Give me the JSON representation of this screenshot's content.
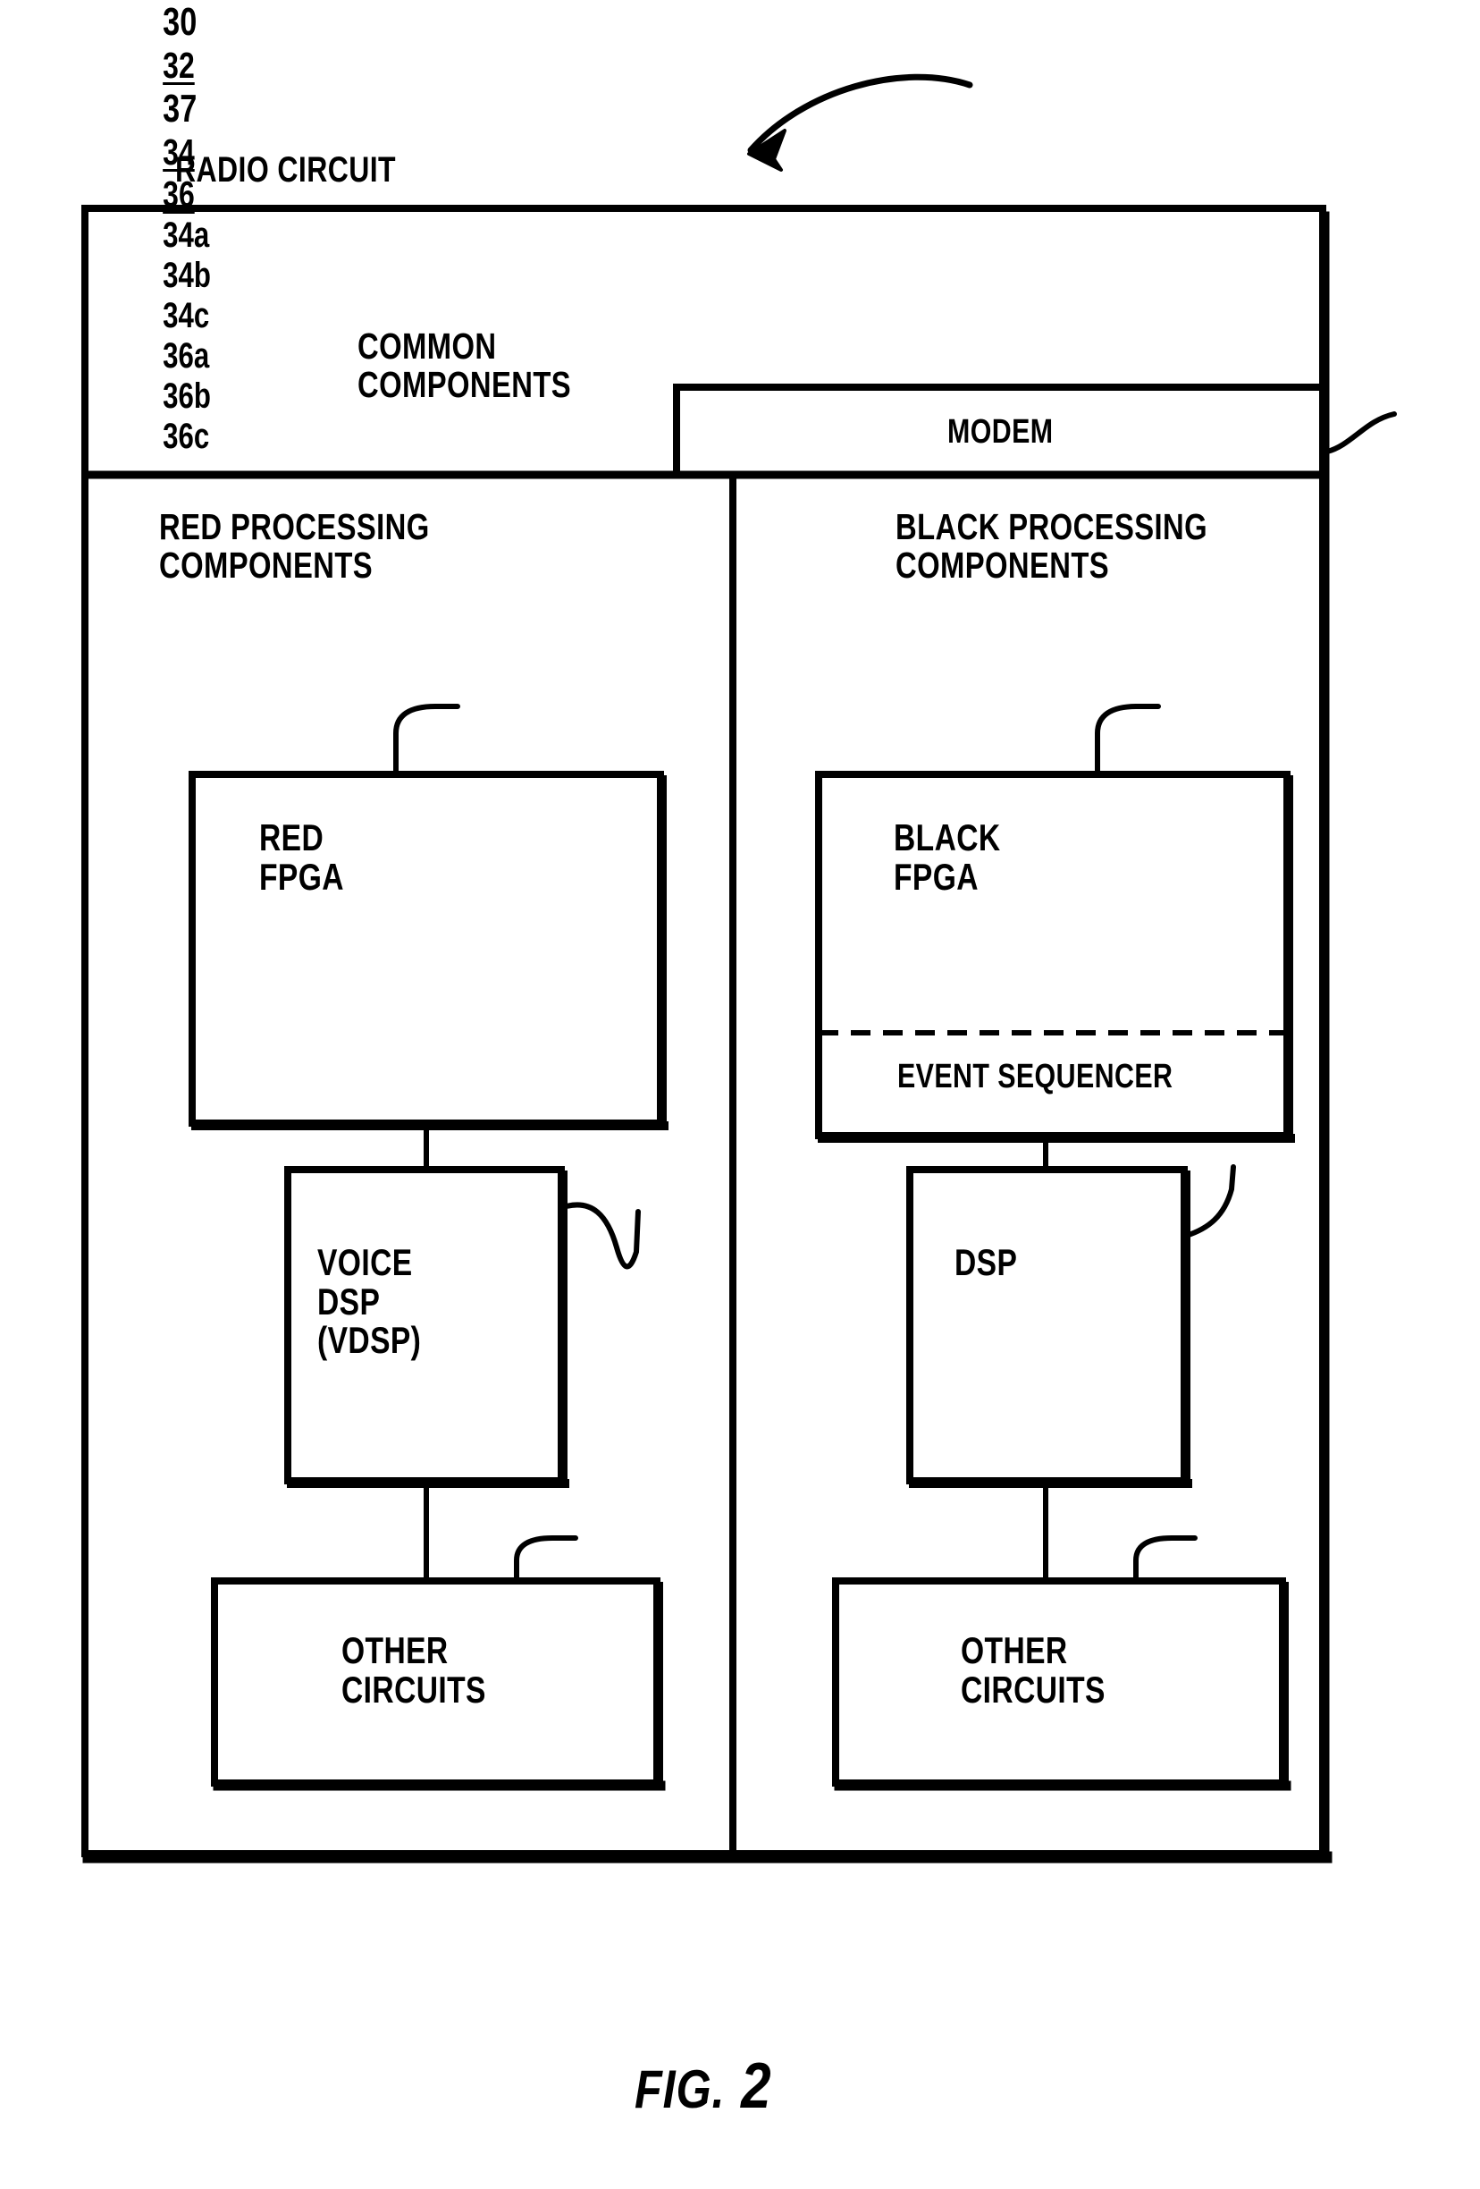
{
  "figure": {
    "caption_prefix": "FIG.",
    "caption_number": "2",
    "title": "RADIO CIRCUIT",
    "root_ref": "30"
  },
  "outer": {
    "label": "RADIO CIRCUIT"
  },
  "common_section": {
    "ref": "32",
    "label": "COMMON\nCOMPONENTS"
  },
  "modem": {
    "label": "MODEM",
    "ref": "37"
  },
  "red_section": {
    "header": "RED PROCESSING\nCOMPONENTS",
    "ref": "34",
    "blocks": [
      {
        "label": "RED\nFPGA",
        "ref": "34a"
      },
      {
        "label": "VOICE\nDSP\n(VDSP)",
        "ref": "34b"
      },
      {
        "label": "OTHER\nCIRCUITS",
        "ref": "34c"
      }
    ]
  },
  "black_section": {
    "header": "BLACK PROCESSING\nCOMPONENTS",
    "ref": "36",
    "blocks": [
      {
        "label": "BLACK\nFPGA",
        "ref": "36a",
        "sub_label": "EVENT SEQUENCER"
      },
      {
        "label": "DSP",
        "ref": "36b"
      },
      {
        "label": "OTHER\nCIRCUITS",
        "ref": "36c"
      }
    ]
  },
  "colors": {
    "ink": "#000000",
    "paper": "#ffffff"
  }
}
